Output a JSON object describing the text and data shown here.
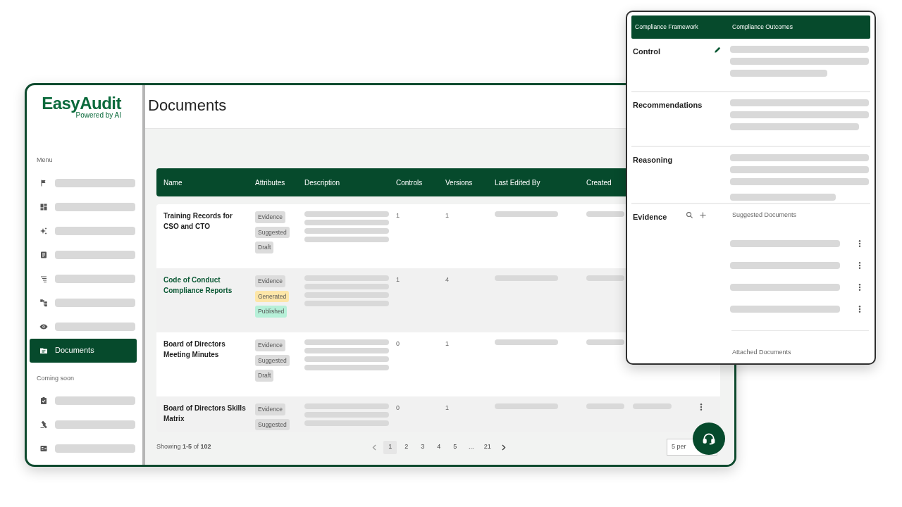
{
  "sidebar": {
    "logo": "EasyAudit",
    "tagline": "Powered by AI",
    "menu_heading": "Menu",
    "menu_items": [
      {
        "selected": false
      },
      {
        "selected": false
      },
      {
        "selected": false
      },
      {
        "selected": false
      },
      {
        "selected": false
      },
      {
        "selected": false
      },
      {
        "selected": false
      },
      {
        "label": "Documents",
        "selected": true
      }
    ],
    "soon_heading": "Coming soon",
    "soon_items": [
      {
        "selected": false
      },
      {
        "selected": false
      },
      {
        "selected": false
      }
    ]
  },
  "page": {
    "title": "Documents"
  },
  "table": {
    "columns": [
      "Name",
      "Attributes",
      "Description",
      "Controls",
      "Versions",
      "Last Edited By",
      "Created"
    ],
    "rows": [
      {
        "name": "Training Records for CSO and CTO",
        "linked": false,
        "controls": "1",
        "versions": "1",
        "tags": [
          {
            "label": "Evidence",
            "color": "#dcdcdc"
          },
          {
            "label": "Suggested",
            "color": "#dcdcdc"
          },
          {
            "label": "Draft",
            "color": "#dcdcdc"
          }
        ]
      },
      {
        "name": "Code of Conduct Compliance Reports",
        "linked": true,
        "controls": "1",
        "versions": "4",
        "tags": [
          {
            "label": "Evidence",
            "color": "#dcdcdc"
          },
          {
            "label": "Generated",
            "color": "#fde6a8"
          },
          {
            "label": "Published",
            "color": "#b6f0d8"
          }
        ]
      },
      {
        "name": "Board of Directors Meeting Minutes",
        "linked": false,
        "controls": "0",
        "versions": "1",
        "tags": [
          {
            "label": "Evidence",
            "color": "#dcdcdc"
          },
          {
            "label": "Suggested",
            "color": "#dcdcdc"
          },
          {
            "label": "Draft",
            "color": "#dcdcdc"
          }
        ]
      },
      {
        "name": "Board of Directors Skills Matrix",
        "linked": false,
        "controls": "0",
        "versions": "1",
        "tags": [
          {
            "label": "Evidence",
            "color": "#dcdcdc"
          },
          {
            "label": "Suggested",
            "color": "#dcdcdc"
          }
        ]
      }
    ]
  },
  "footer": {
    "summary": "Showing **1-5** of **102**",
    "pages": [
      {
        "label": "1",
        "selected": true
      },
      {
        "label": "2",
        "selected": false
      },
      {
        "label": "3",
        "selected": false
      },
      {
        "label": "4",
        "selected": false
      },
      {
        "label": "5",
        "selected": false
      },
      {
        "label": "...",
        "selected": false
      },
      {
        "label": "21",
        "selected": false
      }
    ],
    "per_page": "5 per"
  },
  "panel": {
    "columns": [
      "Compliance Framework",
      "Compliance Outcomes"
    ],
    "sections": [
      {
        "title": "Control",
        "kind": "edit"
      },
      {
        "title": "Recommendations",
        "kind": "plain"
      },
      {
        "title": "Reasoning",
        "kind": "plain"
      },
      {
        "title": "Evidence",
        "kind": "evidence"
      }
    ],
    "suggested_heading": "Suggested Documents",
    "attached_heading": "Attached Documents"
  }
}
